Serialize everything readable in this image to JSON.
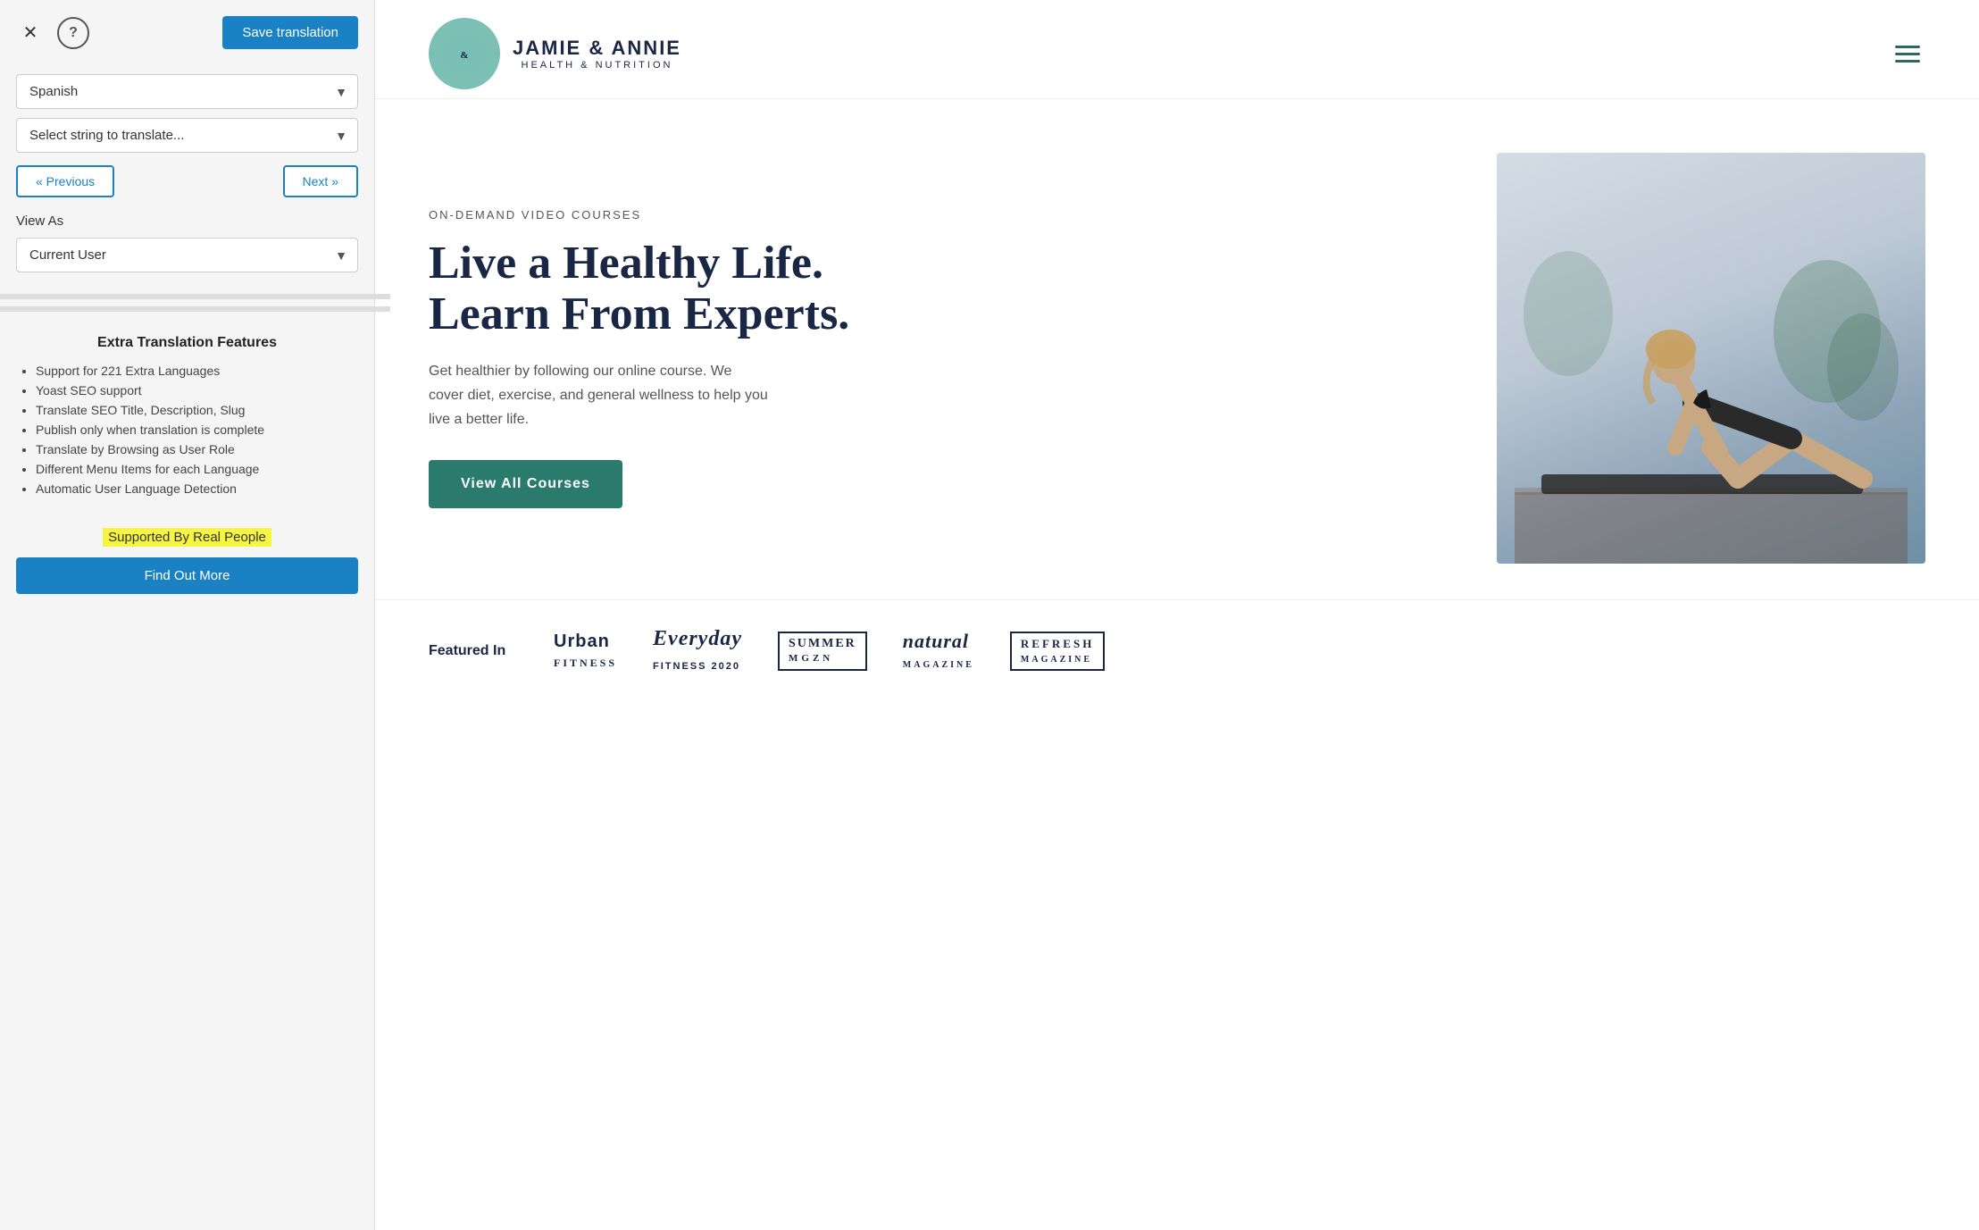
{
  "left_panel": {
    "close_label": "✕",
    "help_label": "?",
    "save_btn_label": "Save translation",
    "language_dropdown": {
      "selected": "Spanish",
      "placeholder": "Spanish"
    },
    "string_dropdown": {
      "placeholder": "Select string to translate..."
    },
    "prev_btn": "« Previous",
    "next_btn": "Next »",
    "view_as_label": "View As",
    "view_as_dropdown": {
      "selected": "Current User"
    },
    "extra_features": {
      "title": "Extra Translation Features",
      "items": [
        "Support for 221 Extra Languages",
        "Yoast SEO support",
        "Translate SEO Title, Description, Slug",
        "Publish only when translation is complete",
        "Translate by Browsing as User Role",
        "Different Menu Items for each Language",
        "Automatic User Language Detection"
      ]
    },
    "supported_text": "Supported By Real People",
    "find_out_btn": "Find Out More"
  },
  "header": {
    "logo_line1": "JAMIE & ANNIE",
    "logo_line2": "HEALTH & NUTRITION",
    "hamburger_label": "Menu"
  },
  "hero": {
    "tag": "ON-DEMAND VIDEO COURSES",
    "title": "Live a Healthy Life. Learn From Experts.",
    "description": "Get healthier by following our online course. We cover diet, exercise, and general wellness to help you live a better life.",
    "cta_btn": "View All Courses"
  },
  "featured": {
    "label": "Featured In",
    "brands": [
      {
        "name": "Urban Fitness",
        "style": "normal"
      },
      {
        "name": "Everyday Fitness 2020",
        "style": "script"
      },
      {
        "name": "SUMMER MGZN",
        "style": "outlined"
      },
      {
        "name": "natural magazine",
        "style": "small-caps"
      },
      {
        "name": "REFRESH MAGAZINE",
        "style": "outlined"
      }
    ]
  }
}
